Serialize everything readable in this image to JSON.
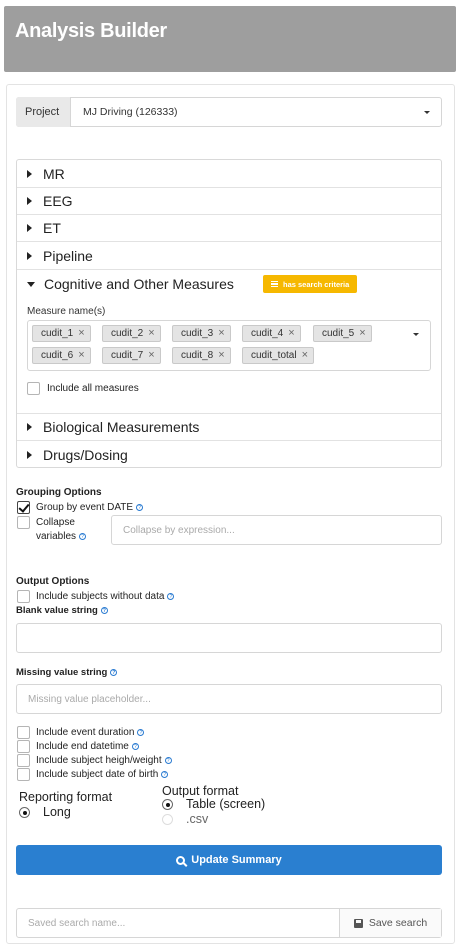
{
  "header": {
    "title": "Analysis Builder"
  },
  "project": {
    "label": "Project",
    "value": "MJ Driving (126333)"
  },
  "accordion": {
    "sections": [
      {
        "label": "MR"
      },
      {
        "label": "EEG"
      },
      {
        "label": "ET"
      },
      {
        "label": "Pipeline"
      },
      {
        "label": "Cognitive and Other Measures",
        "badge": "has search criteria"
      },
      {
        "label": "Biological Measurements"
      },
      {
        "label": "Drugs/Dosing"
      }
    ],
    "measure_label": "Measure name(s)",
    "tags": [
      "cudit_1",
      "cudit_2",
      "cudit_3",
      "cudit_4",
      "cudit_5",
      "cudit_6",
      "cudit_7",
      "cudit_8",
      "cudit_total"
    ],
    "include_all": "Include all measures"
  },
  "grouping": {
    "title": "Grouping Options",
    "group_by_date": "Group by event DATE",
    "collapse_line1": "Collapse",
    "collapse_line2": "variables",
    "collapse_placeholder": "Collapse by expression..."
  },
  "output": {
    "title": "Output Options",
    "include_subjects": "Include subjects without data",
    "blank_label": "Blank value string",
    "missing_label": "Missing value string",
    "missing_placeholder": "Missing value placeholder...",
    "options": [
      "Include event duration",
      "Include end datetime",
      "Include subject heigh/weight",
      "Include subject date of birth"
    ]
  },
  "reporting": {
    "title": "Reporting format",
    "long": "Long"
  },
  "output_format": {
    "title": "Output format",
    "table": "Table (screen)",
    "csv": ".csv"
  },
  "actions": {
    "update": "Update Summary",
    "saved_placeholder": "Saved search name...",
    "save": "Save search"
  },
  "colors": {
    "header": "#9e9e9e",
    "primary": "#2a7fd0",
    "badge": "#f6b800"
  }
}
